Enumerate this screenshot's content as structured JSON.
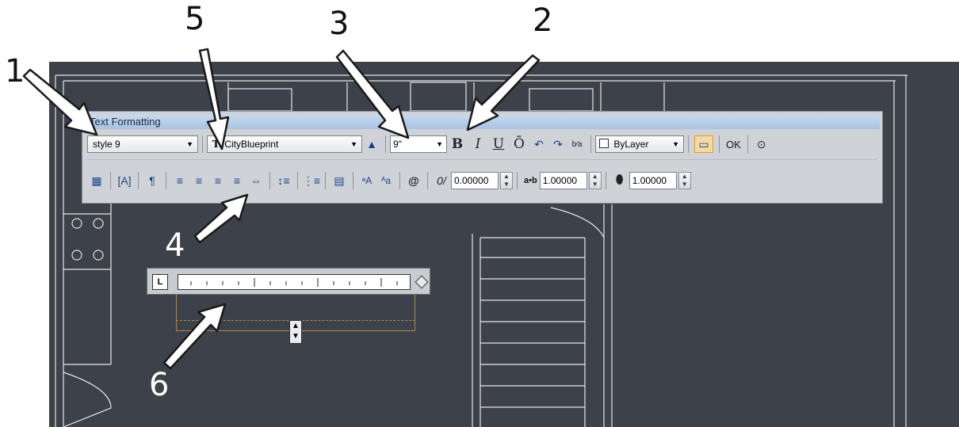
{
  "callouts": {
    "c1": "1",
    "c2": "2",
    "c3": "3",
    "c4": "4",
    "c5": "5",
    "c6": "6"
  },
  "toolbar": {
    "title": "Text Formatting",
    "style": "style 9",
    "font": "CityBlueprint",
    "height": "9\"",
    "bold": "B",
    "italic": "I",
    "underline": "U",
    "overline": "Ō",
    "color": "ByLayer",
    "ok": "OK",
    "oblique_value": "0.00000",
    "tracking_value": "1.00000",
    "width_value": "1.00000",
    "tracking_label": "a•b"
  },
  "colors": {
    "canvas": "#3d4149",
    "titlebar": "#b5cbe6",
    "panel": "#cfd3d8"
  }
}
